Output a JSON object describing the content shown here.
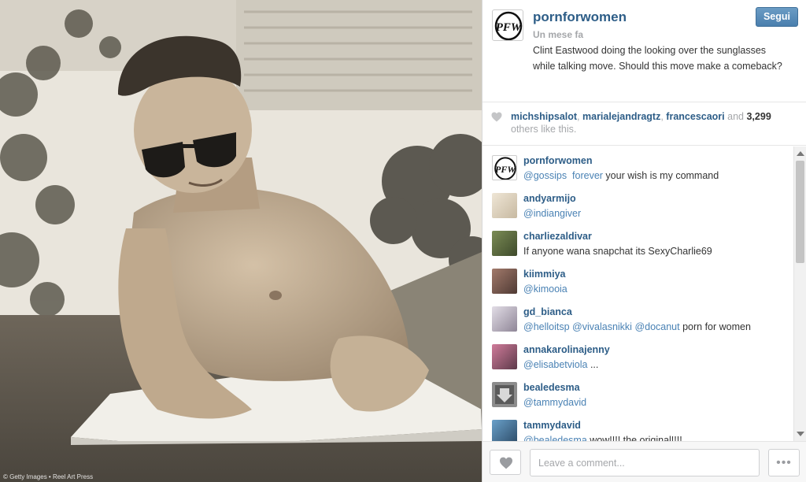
{
  "photo": {
    "credit": "© Getty Images • Reel Art Press",
    "alt_icon": "photo-icon"
  },
  "post": {
    "owner_username": "pornforwomen",
    "owner_avatar_monogram": "PFW",
    "time_ago": "Un mese fa",
    "caption": "Clint Eastwood doing the looking over the sunglasses while talking move. Should this move make a comeback?",
    "follow_label": "Segui"
  },
  "likes": {
    "users": [
      "michshipsalot",
      "marialejandragtz",
      "francescaori"
    ],
    "and_word": "and",
    "count": "3,299",
    "suffix": "others like this."
  },
  "comments": [
    {
      "user": "pornforwomen",
      "mentions": [
        "@gossips"
      ],
      "hashtag": "forever",
      "text": " your wish is my command",
      "avatar": "monogram"
    },
    {
      "user": "andyarmijo",
      "mentions": [
        "@indiangiver"
      ],
      "text": "",
      "avatar": "#d9cfbd"
    },
    {
      "user": "charliezaldivar",
      "mentions": [],
      "text": "If anyone wana snapchat its SexyCharlie69",
      "avatar": "#5a6b3e"
    },
    {
      "user": "kiimmiya",
      "mentions": [
        "@kimooia"
      ],
      "text": "",
      "avatar": "#7a5d58"
    },
    {
      "user": "gd_bianca",
      "mentions": [
        "@helloitsp",
        "@vivalasnikki",
        "@docanut"
      ],
      "text": " porn for women",
      "avatar": "#bdb6c4"
    },
    {
      "user": "annakarolinajenny",
      "mentions": [
        "@elisabetviola"
      ],
      "text": " ...",
      "avatar": "#a0637a"
    },
    {
      "user": "bealedesma",
      "mentions": [
        "@tammydavid"
      ],
      "text": "",
      "avatar": "#6b6b6b"
    },
    {
      "user": "tammydavid",
      "mentions": [
        "@bealedesma"
      ],
      "text": " wow!!!! the original!!!!",
      "avatar": "#3f6a8e"
    }
  ],
  "footer": {
    "comment_placeholder": "Leave a comment...",
    "more_label": "•••"
  },
  "colors": {
    "link_blue": "#2d5d87",
    "mention_blue": "#4a82b4",
    "muted_gray": "#a5a7aa",
    "follow_button": "#4a7fae"
  }
}
